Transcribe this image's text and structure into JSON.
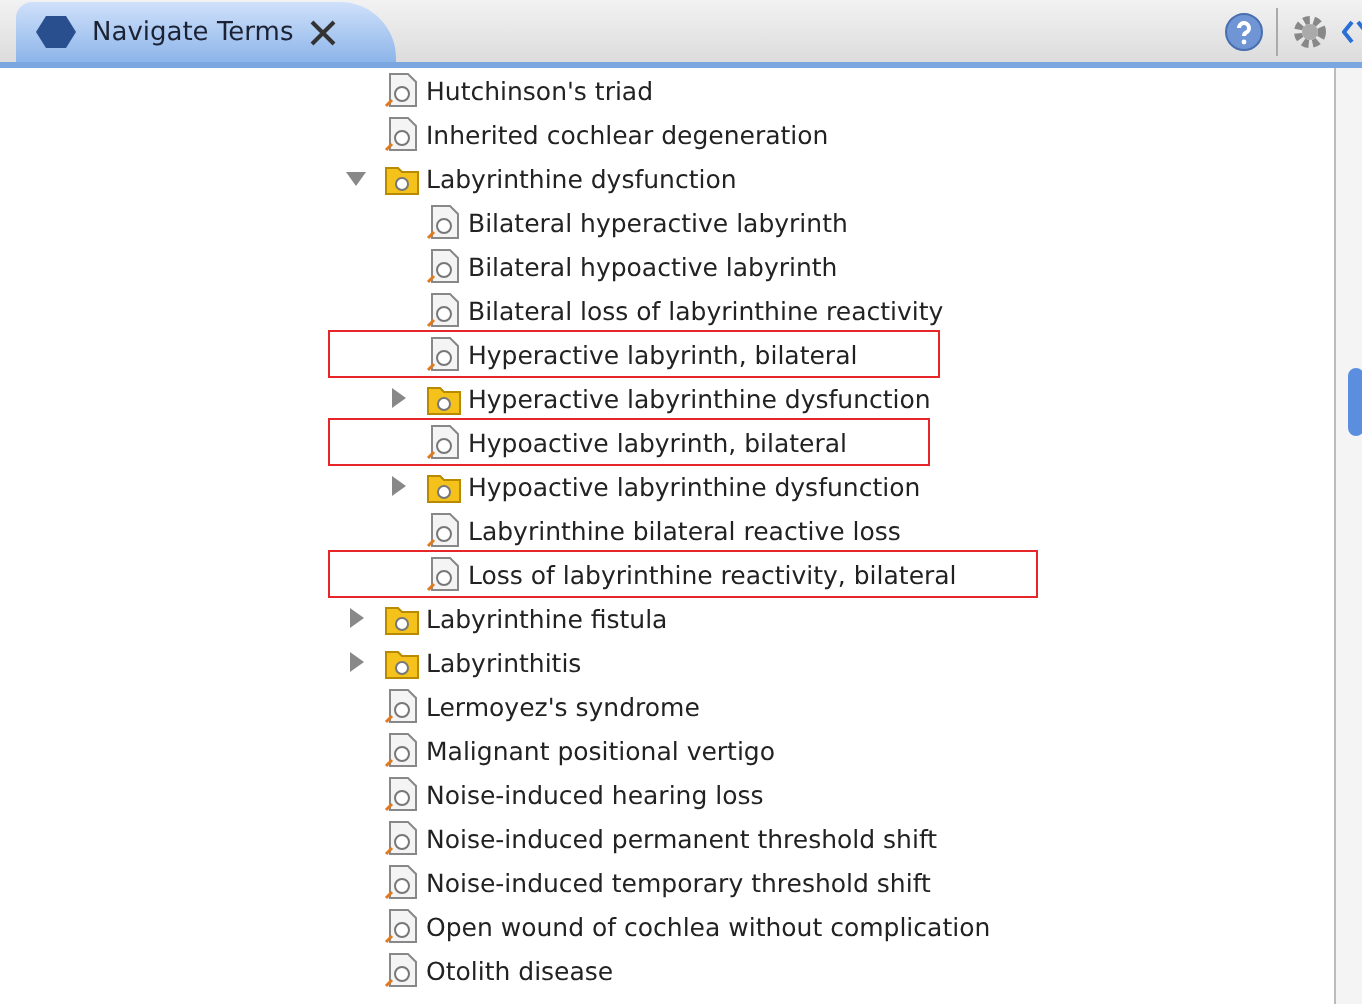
{
  "tab": {
    "title": "Navigate Terms",
    "selected": true
  },
  "tree": [
    {
      "label": "Hutchinson's triad",
      "kind": "term",
      "highlighted": false
    },
    {
      "label": "Inherited cochlear degeneration",
      "kind": "term",
      "highlighted": false
    },
    {
      "label": "Labyrinthine dysfunction",
      "kind": "folder",
      "expanded": true,
      "highlighted": false,
      "children": [
        {
          "label": "Bilateral hyperactive labyrinth",
          "kind": "term",
          "highlighted": false
        },
        {
          "label": "Bilateral hypoactive labyrinth",
          "kind": "term",
          "highlighted": false
        },
        {
          "label": "Bilateral loss of labyrinthine reactivity",
          "kind": "term",
          "highlighted": false
        },
        {
          "label": "Hyperactive labyrinth, bilateral",
          "kind": "term",
          "highlighted": true
        },
        {
          "label": "Hyperactive labyrinthine dysfunction",
          "kind": "folder",
          "expanded": false,
          "highlighted": false
        },
        {
          "label": "Hypoactive labyrinth, bilateral",
          "kind": "term",
          "highlighted": true
        },
        {
          "label": "Hypoactive labyrinthine dysfunction",
          "kind": "folder",
          "expanded": false,
          "highlighted": false
        },
        {
          "label": "Labyrinthine bilateral reactive loss",
          "kind": "term",
          "highlighted": false
        },
        {
          "label": "Loss of labyrinthine reactivity, bilateral",
          "kind": "term",
          "highlighted": true
        }
      ]
    },
    {
      "label": "Labyrinthine fistula",
      "kind": "folder",
      "expanded": false,
      "highlighted": false
    },
    {
      "label": "Labyrinthitis",
      "kind": "folder",
      "expanded": false,
      "highlighted": false
    },
    {
      "label": "Lermoyez's syndrome",
      "kind": "term",
      "highlighted": false
    },
    {
      "label": "Malignant positional vertigo",
      "kind": "term",
      "highlighted": false
    },
    {
      "label": "Noise-induced hearing loss",
      "kind": "term",
      "highlighted": false
    },
    {
      "label": "Noise-induced permanent threshold shift",
      "kind": "term",
      "highlighted": false
    },
    {
      "label": "Noise-induced temporary threshold shift",
      "kind": "term",
      "highlighted": false
    },
    {
      "label": "Open wound of cochlea without complication",
      "kind": "term",
      "highlighted": false
    },
    {
      "label": "Otolith disease",
      "kind": "term",
      "highlighted": false
    }
  ]
}
